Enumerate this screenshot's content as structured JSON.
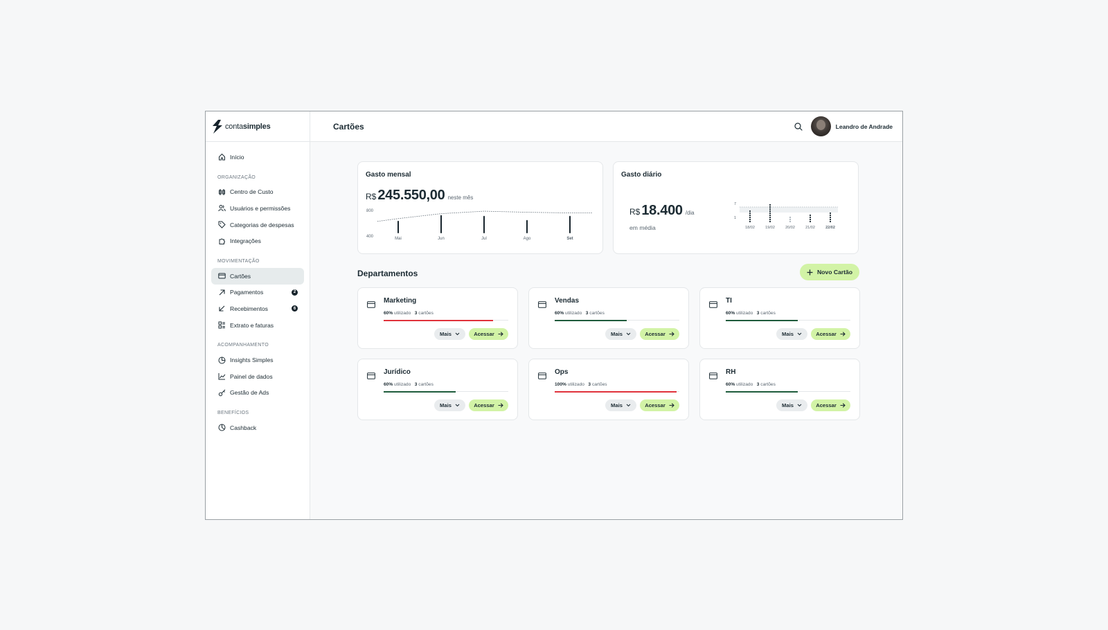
{
  "brand": {
    "name_light": "conta",
    "name_bold": "simples"
  },
  "sidebar": {
    "home": {
      "label": "Início",
      "icon": "home-icon"
    },
    "sections": [
      {
        "title": "ORGANIZAÇÃO",
        "items": [
          {
            "label": "Centro de Custo",
            "icon": "cost-center-icon"
          },
          {
            "label": "Usuários e permissões",
            "icon": "users-icon"
          },
          {
            "label": "Categorias de despesas",
            "icon": "tags-icon"
          },
          {
            "label": "Integrações",
            "icon": "puzzle-icon"
          }
        ]
      },
      {
        "title": "MOVIMENTAÇÃO",
        "items": [
          {
            "label": "Cartões",
            "icon": "card-icon",
            "active": true
          },
          {
            "label": "Pagamentos",
            "icon": "arrow-up-right-icon",
            "badge": "2"
          },
          {
            "label": "Recebimentos",
            "icon": "arrow-down-left-icon",
            "badge": "6"
          },
          {
            "label": "Extrato e faturas",
            "icon": "statement-icon"
          }
        ]
      },
      {
        "title": "ACOMPANHAMENTO",
        "items": [
          {
            "label": "Insights Simples",
            "icon": "pie-icon"
          },
          {
            "label": "Painel de dados",
            "icon": "line-chart-icon"
          },
          {
            "label": "Gestão de Ads",
            "icon": "key-icon"
          }
        ]
      },
      {
        "title": "BENEFÍCIOS",
        "items": [
          {
            "label": "Cashback",
            "icon": "cashback-icon"
          }
        ]
      }
    ]
  },
  "header": {
    "title": "Cartões",
    "user_name": "Leandro de Andrade"
  },
  "monthly": {
    "title": "Gasto mensal",
    "currency": "R$",
    "amount": "245.550,00",
    "suffix": "neste mês"
  },
  "daily": {
    "title": "Gasto diário",
    "currency": "R$",
    "amount": "18.400",
    "suffix": "/dia",
    "sub": "em média"
  },
  "chart_data": [
    {
      "type": "bar",
      "title": "",
      "categories": [
        "Mai",
        "Jun",
        "Jul",
        "Ago",
        "Set"
      ],
      "values": [
        500,
        660,
        640,
        520,
        640
      ],
      "trend": [
        580,
        720,
        790,
        760,
        740
      ],
      "yticks": [
        "800",
        "400"
      ],
      "ylim": [
        300,
        850
      ],
      "highlight": "Set"
    },
    {
      "type": "bar",
      "title": "",
      "categories": [
        "18/02",
        "19/02",
        "20/02",
        "21/02",
        "22/02"
      ],
      "values": [
        5,
        7,
        2,
        3,
        4
      ],
      "yticks": [
        "7",
        "1"
      ],
      "ylim": [
        0,
        7.5
      ],
      "highlight": "22/02"
    }
  ],
  "departments": {
    "title": "Departamentos",
    "new_button": "Novo Cartão",
    "more_label": "Mais",
    "access_label": "Acessar",
    "used_label": "utilizado",
    "cards_label": "cartões",
    "colors": {
      "ok": "#1e5b3c",
      "over": "#e0313a"
    },
    "items": [
      {
        "name": "Marketing",
        "pct": "60%",
        "count": "3",
        "fill": 0.88,
        "status": "over"
      },
      {
        "name": "Vendas",
        "pct": "60%",
        "count": "3",
        "fill": 0.58,
        "status": "ok"
      },
      {
        "name": "TI",
        "pct": "60%",
        "count": "3",
        "fill": 0.58,
        "status": "ok"
      },
      {
        "name": "Jurídico",
        "pct": "60%",
        "count": "3",
        "fill": 0.58,
        "status": "ok"
      },
      {
        "name": "Ops",
        "pct": "100%",
        "count": "3",
        "fill": 0.98,
        "status": "over"
      },
      {
        "name": "RH",
        "pct": "60%",
        "count": "3",
        "fill": 0.58,
        "status": "ok"
      }
    ]
  }
}
